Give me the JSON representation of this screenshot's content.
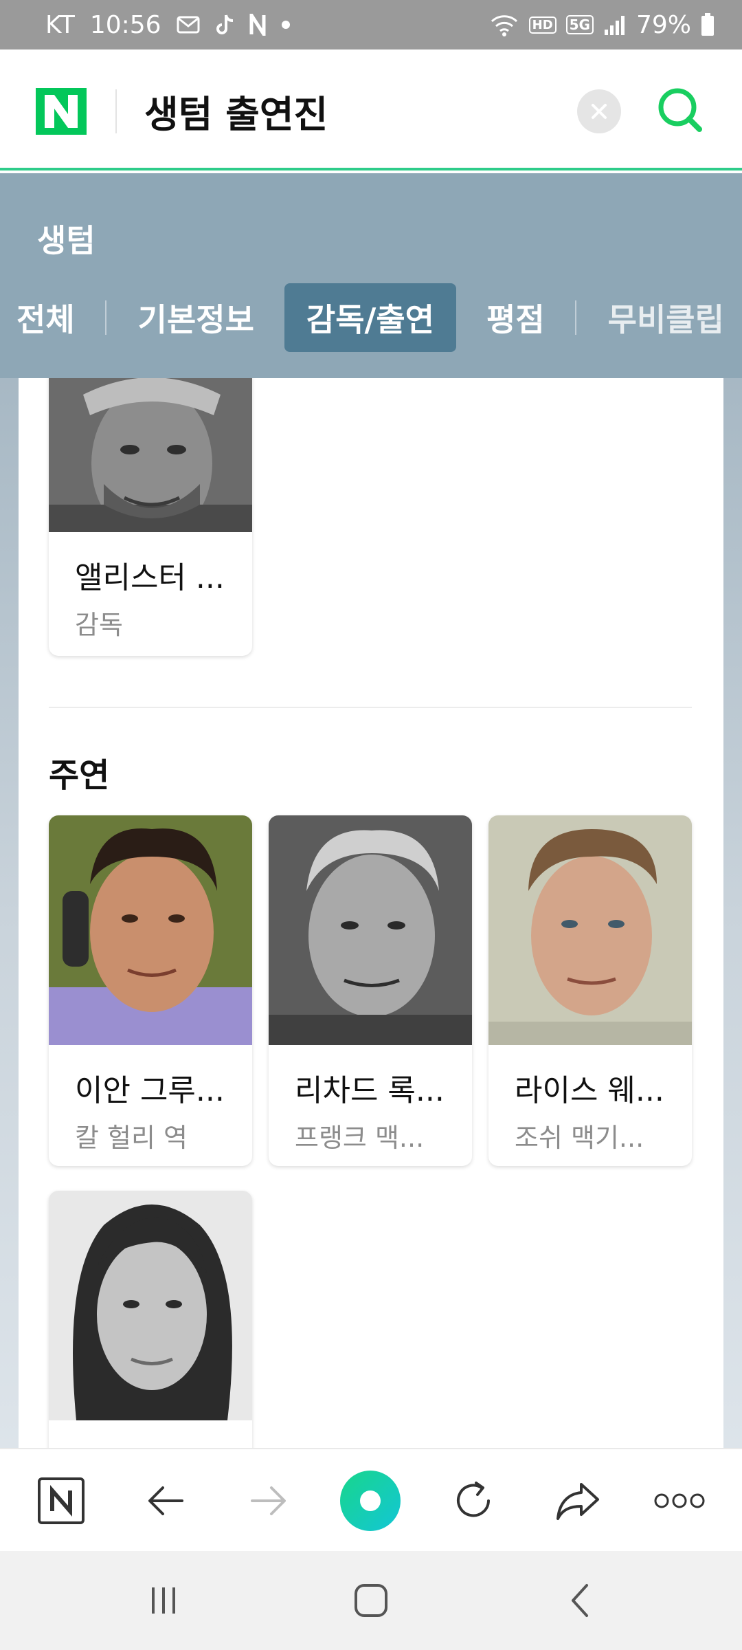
{
  "status_bar": {
    "carrier": "KT",
    "time": "10:56",
    "network_badges": [
      "HD",
      "5G"
    ],
    "battery": "79%",
    "icons": [
      "mail-icon",
      "tiktok-icon",
      "naver-n-icon",
      "dot-icon",
      "wifi-icon",
      "signal-icon",
      "battery-icon"
    ]
  },
  "header": {
    "query": "생텀 출연진",
    "logo_icon": "naver-logo",
    "colors": {
      "brand": "#03c75a",
      "search": "#19ce60"
    }
  },
  "movie": {
    "title": "생텀",
    "tabs": [
      {
        "label": "전체",
        "active": false
      },
      {
        "label": "기본정보",
        "active": false
      },
      {
        "label": "감독/출연",
        "active": true
      },
      {
        "label": "평점",
        "active": false
      },
      {
        "label": "무비클립",
        "active": false
      }
    ]
  },
  "director": {
    "name": "앨리스터 ...",
    "role": "감독"
  },
  "main_cast": {
    "title": "주연",
    "people": [
      {
        "name": "이안 그루...",
        "role": "칼 헐리 역"
      },
      {
        "name": "리차드 록...",
        "role": "프랭크 맥..."
      },
      {
        "name": "라이스 웨...",
        "role": "조쉬 맥기..."
      },
      {
        "name": "",
        "role": ""
      }
    ]
  },
  "toolbar": {
    "icons": [
      "naver-home-icon",
      "back-arrow-icon",
      "forward-arrow-icon",
      "green-dot-icon",
      "refresh-icon",
      "share-icon",
      "more-icon"
    ]
  },
  "navbar": {
    "icons": [
      "recents-icon",
      "home-icon",
      "back-icon"
    ]
  }
}
